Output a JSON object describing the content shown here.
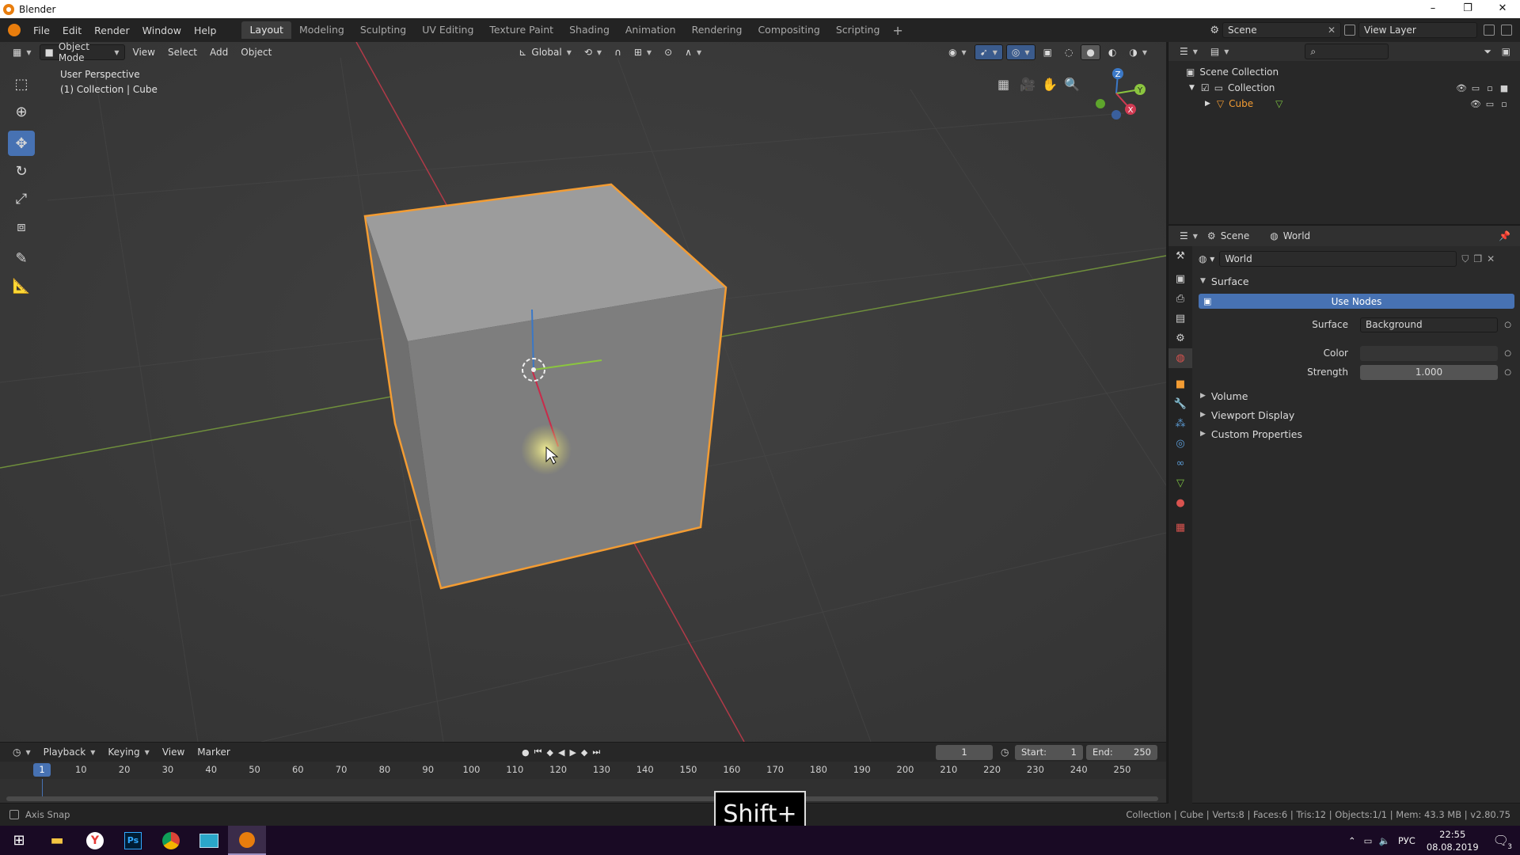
{
  "window": {
    "title": "Blender",
    "controls": [
      "–",
      "❐",
      "✕"
    ]
  },
  "menubar": {
    "items": [
      "File",
      "Edit",
      "Render",
      "Window",
      "Help"
    ],
    "workspaces": [
      "Layout",
      "Modeling",
      "Sculpting",
      "UV Editing",
      "Texture Paint",
      "Shading",
      "Animation",
      "Rendering",
      "Compositing",
      "Scripting"
    ],
    "active_workspace": "Layout",
    "add_tab": "+",
    "scene_name": "Scene",
    "view_layer": "View Layer"
  },
  "viewport": {
    "mode": "Object Mode",
    "menus": [
      "View",
      "Select",
      "Add",
      "Object"
    ],
    "orientation": "Global",
    "info_line1": "User Perspective",
    "info_line2": "(1) Collection | Cube",
    "gizmo_axes": [
      "Z",
      "Y",
      "X"
    ],
    "colors": {
      "bg": "#3c3c3c",
      "x_axis": "#c33b47",
      "y_axis": "#7aa137",
      "selection": "#f39c33",
      "cube_top": "#9b9b9b",
      "cube_front": "#7d7d7d",
      "cube_side": "#747474"
    }
  },
  "tools": [
    "select-box",
    "cursor",
    "move",
    "rotate",
    "scale",
    "transform",
    "annotate",
    "measure"
  ],
  "active_tool": "move",
  "timeline": {
    "menus": [
      "Playback",
      "Keying",
      "View",
      "Marker"
    ],
    "current_frame": "1",
    "start_label": "Start:",
    "start": "1",
    "end_label": "End:",
    "end": "250",
    "ruler_ticks": [
      "1",
      "10",
      "20",
      "30",
      "40",
      "50",
      "60",
      "70",
      "80",
      "90",
      "100",
      "110",
      "120",
      "130",
      "140",
      "150",
      "160",
      "170",
      "180",
      "190",
      "200",
      "210",
      "220",
      "230",
      "240",
      "250"
    ]
  },
  "statusbar": {
    "left": "Axis Snap",
    "right": "Collection | Cube | Verts:8 | Faces:6 | Tris:12 | Objects:1/1 | Mem: 43.3 MB | v2.80.75"
  },
  "key_overlay": "Shift+",
  "outliner": {
    "root": "Scene Collection",
    "collection": "Collection",
    "object": "Cube"
  },
  "properties": {
    "breadcrumb_scene": "Scene",
    "breadcrumb_world": "World",
    "world_name": "World",
    "surface_panel": "Surface",
    "use_nodes": "Use Nodes",
    "surface_label": "Surface",
    "surface_value": "Background",
    "color_label": "Color",
    "strength_label": "Strength",
    "strength_value": "1.000",
    "collapsed_panels": [
      "Volume",
      "Viewport Display",
      "Custom Properties"
    ]
  },
  "taskbar": {
    "lang": "РУС",
    "time": "22:55",
    "date": "08.08.2019",
    "notifications": "3"
  }
}
